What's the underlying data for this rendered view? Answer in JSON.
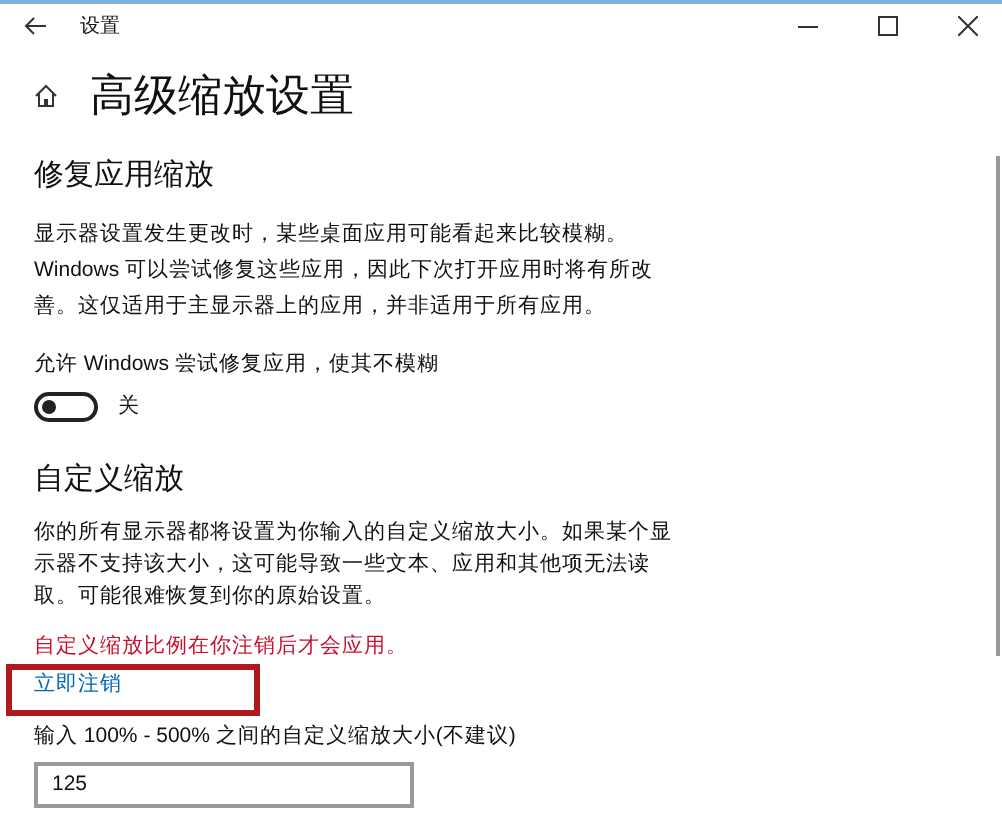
{
  "window": {
    "title": "设置"
  },
  "page": {
    "title": "高级缩放设置"
  },
  "fix_section": {
    "heading": "修复应用缩放",
    "description": "显示器设置发生更改时，某些桌面应用可能看起来比较模糊。Windows 可以尝试修复这些应用，因此下次打开应用时将有所改善。这仅适用于主显示器上的应用，并非适用于所有应用。",
    "toggle_label": "允许 Windows 尝试修复应用，使其不模糊",
    "toggle": {
      "on": false,
      "state_text": "关"
    }
  },
  "custom_section": {
    "heading": "自定义缩放",
    "description": "你的所有显示器都将设置为你输入的自定义缩放大小。如果某个显示器不支持该大小，这可能导致一些文本、应用和其他项无法读取。可能很难恢复到你的原始设置。",
    "warning": "自定义缩放比例在你注销后才会应用。",
    "link": "立即注销",
    "input_label": "输入 100% - 500% 之间的自定义缩放大小(不建议)",
    "input_value": "125"
  }
}
